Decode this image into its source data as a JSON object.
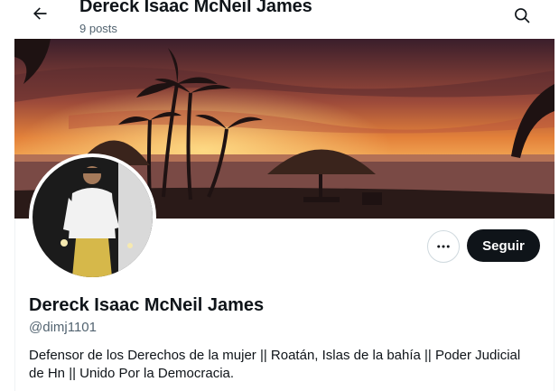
{
  "header": {
    "display_name": "Dereck Isaac McNeil James",
    "post_count": "9 posts"
  },
  "icons": {
    "back": "arrow-left-icon",
    "search": "search-icon",
    "more": "more-horizontal-icon"
  },
  "banner": {
    "description_colors": {
      "sky_top": "#3a1e2b",
      "sky_glow": "#f39a3a",
      "sea": "#7a4a45",
      "sand": "#2a1a18"
    }
  },
  "actions": {
    "follow_label": "Seguir"
  },
  "profile": {
    "display_name": "Dereck Isaac McNeil James",
    "handle": "@dimj1101",
    "bio": "Defensor de los Derechos de la mujer || Roatán, Islas de la bahía || Poder Judicial de Hn || Unido Por la Democracia."
  },
  "colors": {
    "text_primary": "#0f1419",
    "text_secondary": "#536471",
    "follow_bg": "#0f1419",
    "border": "#cfd9de"
  }
}
